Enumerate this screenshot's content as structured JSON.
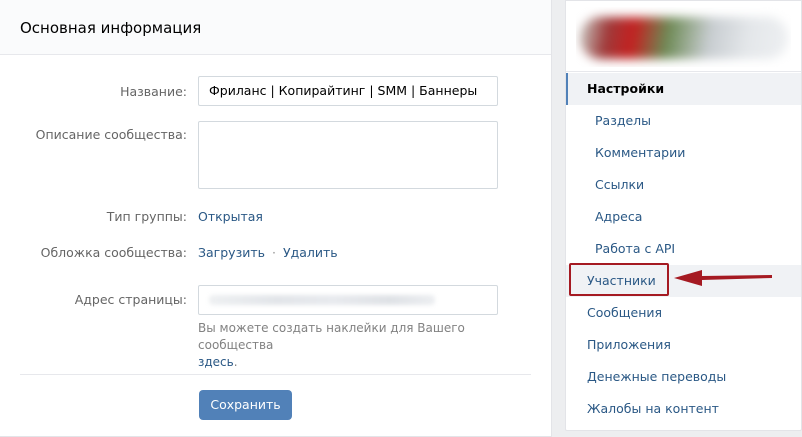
{
  "main": {
    "title": "Основная информация",
    "name_label": "Название:",
    "name_value": "Фриланс | Копирайтинг | SMM | Баннеры",
    "description_label": "Описание сообщества:",
    "description_value": "",
    "group_type_label": "Тип группы:",
    "group_type_value": "Открытая",
    "cover_label": "Обложка сообщества:",
    "cover_upload": "Загрузить",
    "cover_separator": "·",
    "cover_delete": "Удалить",
    "address_label": "Адрес страницы:",
    "address_hint_text": "Вы можете создать наклейки для Вашего сообщества",
    "address_hint_link": "здесь",
    "address_hint_end": ".",
    "save_label": "Сохранить"
  },
  "sidebar": {
    "items": [
      {
        "label": "Настройки",
        "state": "active"
      },
      {
        "label": "Разделы",
        "state": "sub"
      },
      {
        "label": "Комментарии",
        "state": "sub"
      },
      {
        "label": "Ссылки",
        "state": "sub"
      },
      {
        "label": "Адреса",
        "state": "sub"
      },
      {
        "label": "Работа с API",
        "state": "sub"
      },
      {
        "label": "Участники",
        "state": "highlighted"
      },
      {
        "label": "Сообщения",
        "state": "normal"
      },
      {
        "label": "Приложения",
        "state": "normal"
      },
      {
        "label": "Денежные переводы",
        "state": "normal"
      },
      {
        "label": "Жалобы на контент",
        "state": "normal"
      }
    ]
  },
  "colors": {
    "accent": "#5181b8",
    "link": "#2a5885",
    "annotation": "#a51a22"
  },
  "annotation": {
    "icon": "red-arrow-icon"
  }
}
